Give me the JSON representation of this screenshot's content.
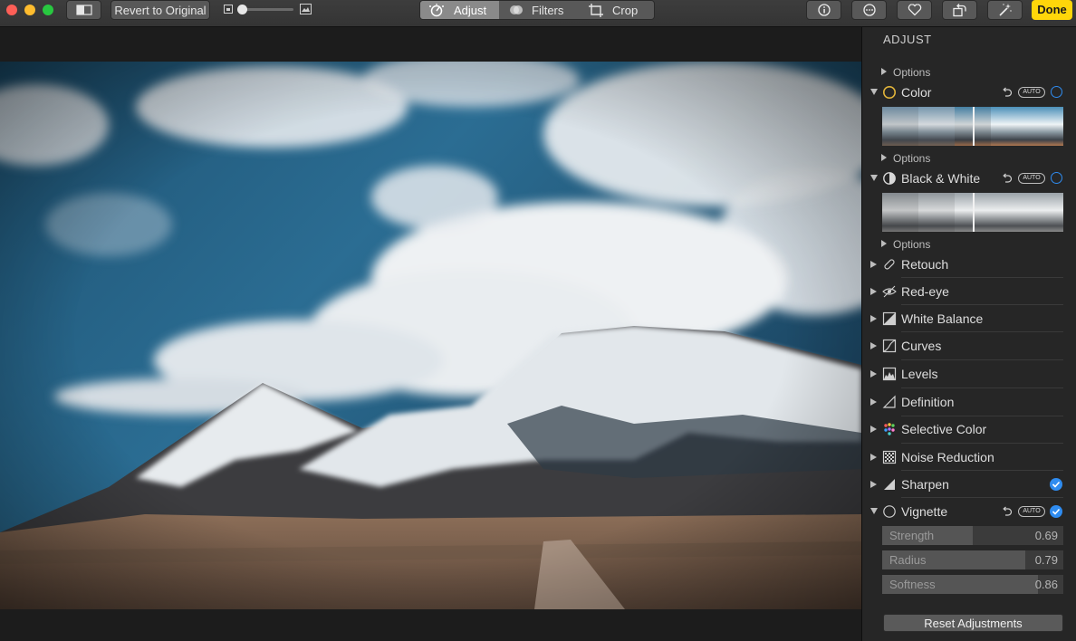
{
  "toolbar": {
    "revert_label": "Revert to Original",
    "tabs": [
      {
        "label": "Adjust",
        "icon": "adjust-dial-icon",
        "active": true
      },
      {
        "label": "Filters",
        "icon": "filters-circles-icon",
        "active": false
      },
      {
        "label": "Crop",
        "icon": "crop-icon",
        "active": false
      }
    ],
    "right_icons": [
      "info-icon",
      "more-ellipsis-icon",
      "favorite-heart-icon",
      "rotate-icon",
      "enhance-wand-icon"
    ],
    "done_label": "Done"
  },
  "panel": {
    "title": "ADJUST",
    "options_label": "Options",
    "auto_label": "AUTO",
    "sections": [
      {
        "label": "Color",
        "expanded": true,
        "icon": "color-circle-icon"
      },
      {
        "label": "Black & White",
        "expanded": true,
        "icon": "half-circle-icon"
      },
      {
        "label": "Retouch",
        "expanded": false,
        "icon": "bandage-icon"
      },
      {
        "label": "Red-eye",
        "expanded": false,
        "icon": "eye-icon"
      },
      {
        "label": "White Balance",
        "expanded": false,
        "icon": "white-balance-icon"
      },
      {
        "label": "Curves",
        "expanded": false,
        "icon": "curves-icon"
      },
      {
        "label": "Levels",
        "expanded": false,
        "icon": "levels-icon"
      },
      {
        "label": "Definition",
        "expanded": false,
        "icon": "definition-triangle-icon"
      },
      {
        "label": "Selective Color",
        "expanded": false,
        "icon": "selective-color-dots-icon"
      },
      {
        "label": "Noise Reduction",
        "expanded": false,
        "icon": "noise-reduction-icon"
      },
      {
        "label": "Sharpen",
        "expanded": false,
        "icon": "sharpen-triangle-icon",
        "enabled": true
      },
      {
        "label": "Vignette",
        "expanded": true,
        "icon": "vignette-circle-icon",
        "enabled": true
      }
    ],
    "vignette_sliders": [
      {
        "label": "Strength",
        "value": "0.69",
        "fill": 0.5
      },
      {
        "label": "Radius",
        "value": "0.79",
        "fill": 0.79
      },
      {
        "label": "Softness",
        "value": "0.86",
        "fill": 0.86
      }
    ],
    "reset_label": "Reset Adjustments"
  },
  "colors": {
    "accent_blue": "#2f8cf0",
    "done_yellow": "#ffd60a",
    "panel_bg": "#262626"
  }
}
